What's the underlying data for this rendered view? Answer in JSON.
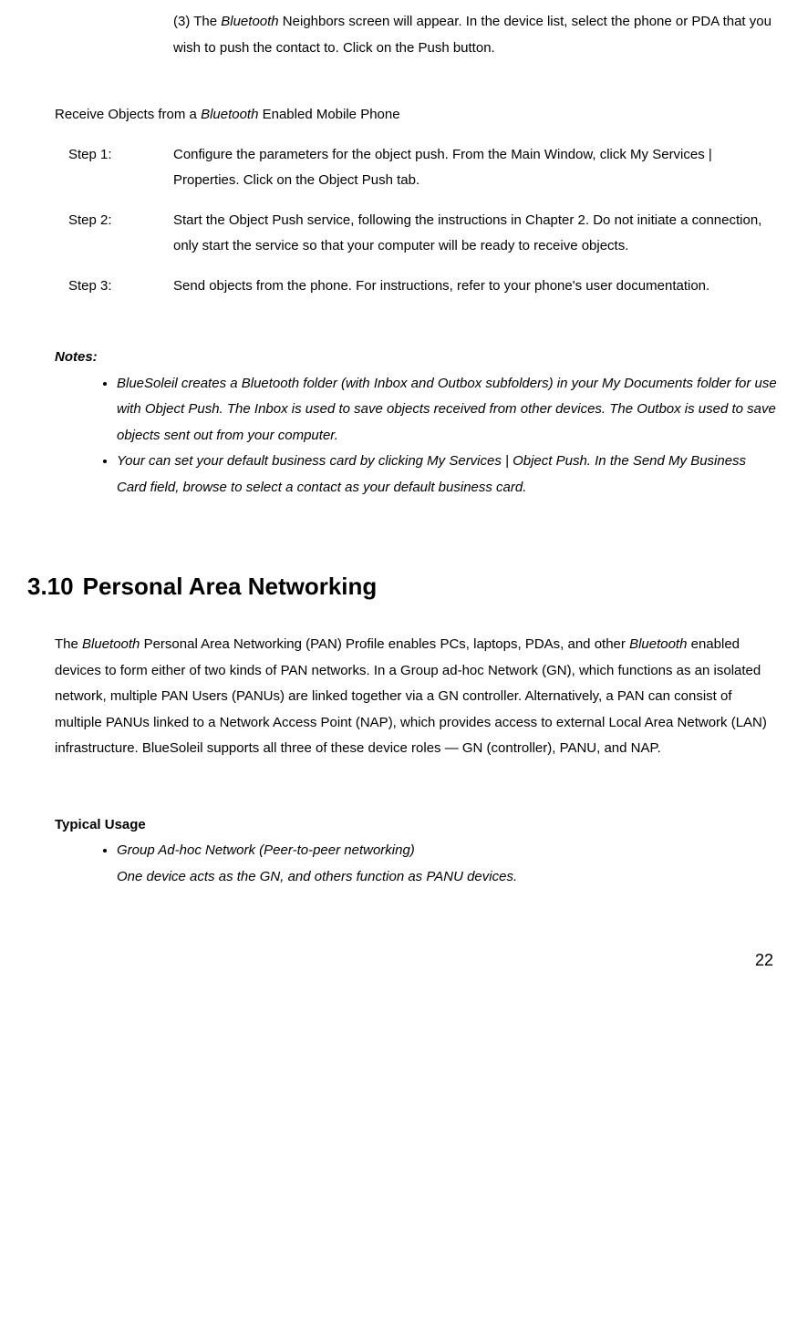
{
  "top_paragraph": {
    "prefix": "(3) The ",
    "bluetooth": "Bluetooth",
    "rest": " Neighbors screen will appear. In the device list, select the phone or PDA that you wish to push the contact to. Click on the Push button."
  },
  "receive_section": {
    "heading_pre": "Receive Objects from a ",
    "heading_em": "Bluetooth",
    "heading_post": " Enabled Mobile Phone",
    "steps": [
      {
        "label": "Step 1:",
        "text": "Configure the parameters for the object push. From the Main Window, click My Services | Properties. Click on the Object Push tab."
      },
      {
        "label": "Step 2:",
        "text": "Start the Object Push service, following the instructions in Chapter 2. Do not initiate a connection, only start the service so that your computer will be ready to receive objects."
      },
      {
        "label": "Step 3:",
        "text": "Send objects from the phone. For instructions, refer to your phone's user documentation."
      }
    ]
  },
  "notes": {
    "heading": "Notes:",
    "items": [
      "BlueSoleil creates a Bluetooth folder (with Inbox and Outbox subfolders) in your My Documents folder for use with Object Push. The Inbox is used to save objects received from other devices. The Outbox is used to save objects sent out from your computer.",
      "Your can set your default business card by clicking My Services | Object Push. In the Send My Business Card field, browse to select a contact as your default business card."
    ]
  },
  "section_3_10": {
    "number": "3.10",
    "title": "Personal Area Networking",
    "para_pre": "The ",
    "para_em1": "Bluetooth",
    "para_mid": " Personal Area Networking (PAN) Profile enables PCs, laptops, PDAs, and other ",
    "para_em2": "Bluetooth",
    "para_post": " enabled devices to form either of two kinds of PAN networks. In a Group ad-hoc Network (GN), which functions as an isolated network, multiple PAN Users (PANUs) are linked together via a GN controller. Alternatively, a PAN can consist of multiple PANUs linked to a Network Access Point (NAP), which provides access to external Local Area Network (LAN) infrastructure. BlueSoleil supports all three of these device roles — GN (controller), PANU, and NAP."
  },
  "typical_usage": {
    "heading": "Typical Usage",
    "item_title": "Group Ad-hoc Network (Peer-to-peer networking)",
    "item_body": "One device acts as the GN, and others function as PANU devices."
  },
  "page_number": "22"
}
